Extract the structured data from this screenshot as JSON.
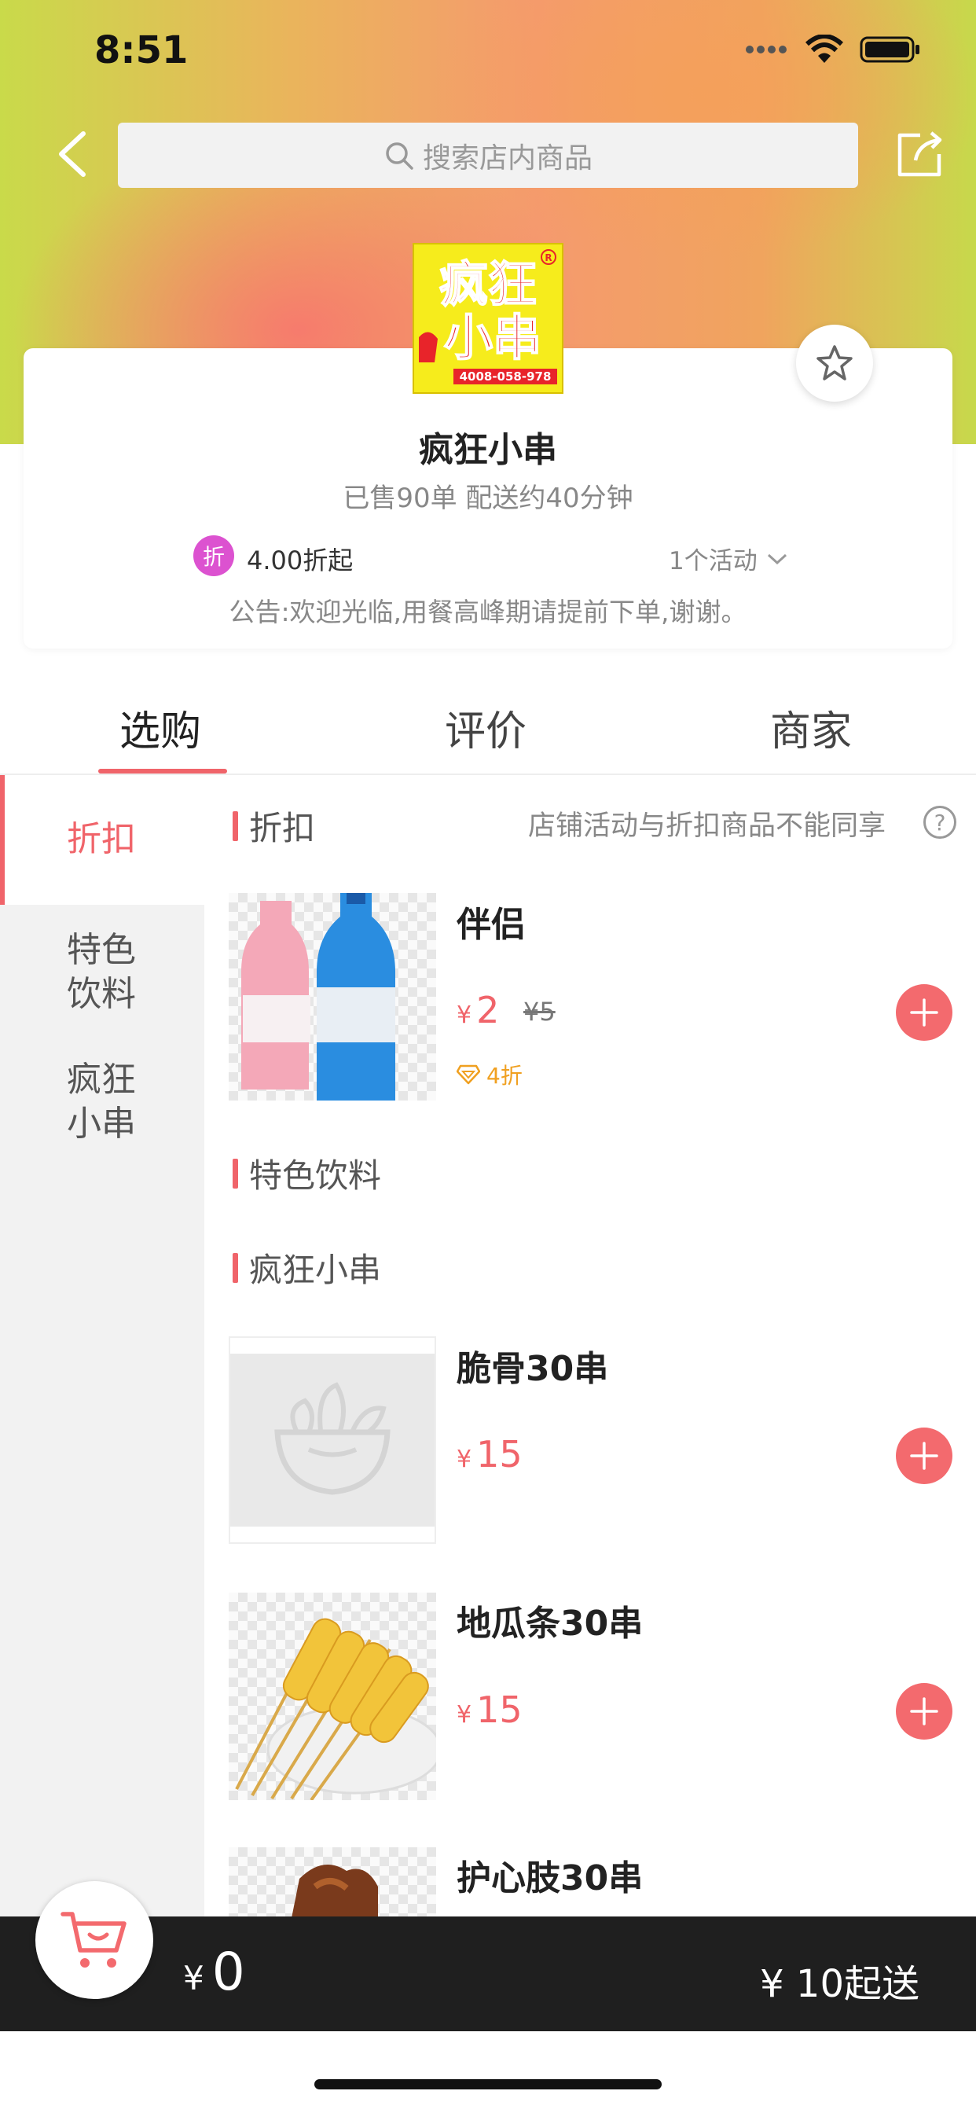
{
  "status_bar": {
    "time": "8:51"
  },
  "header": {
    "search_placeholder": "搜索店内商品"
  },
  "shop": {
    "logo_text_line1": "疯狂",
    "logo_text_line2": "小串",
    "logo_phone": "4008-058-978",
    "name": "疯狂小串",
    "meta": "已售90单  配送约40分钟",
    "discount_badge": "折",
    "discount_text": "4.00折起",
    "activities_label": "1个活动",
    "notice": "公告:欢迎光临,用餐高峰期请提前下单,谢谢。"
  },
  "tabs": [
    {
      "label": "选购",
      "active": true
    },
    {
      "label": "评价",
      "active": false
    },
    {
      "label": "商家",
      "active": false
    }
  ],
  "sidebar": {
    "items": [
      {
        "label": "折扣",
        "active": true
      },
      {
        "label": "特色\n饮料",
        "active": false
      },
      {
        "label": "疯狂\n小串",
        "active": false
      }
    ]
  },
  "sections": {
    "discount": {
      "title": "折扣",
      "note": "店铺活动与折扣商品不能同享",
      "help": "?"
    },
    "drinks": {
      "title": "特色饮料"
    },
    "skewers": {
      "title": "疯狂小串"
    }
  },
  "products": [
    {
      "name": "伴侣",
      "currency": "¥",
      "price": "2",
      "old_price": "¥5",
      "tag": "4折",
      "image": "bottled-drinks"
    },
    {
      "name": "脆骨30串",
      "currency": "¥",
      "price": "15",
      "image": "placeholder-bowl"
    },
    {
      "name": "地瓜条30串",
      "currency": "¥",
      "price": "15",
      "image": "sweet-potato-skewers"
    },
    {
      "name": "护心肢30串",
      "image": "meat-skewers"
    }
  ],
  "cart": {
    "currency": "¥",
    "total": "0",
    "min_order": "¥ 10起送"
  },
  "colors": {
    "accent": "#f0646a",
    "discount_badge": "#dc52d0",
    "cart_bar": "#1f1f1f",
    "tag": "#f0a020"
  }
}
